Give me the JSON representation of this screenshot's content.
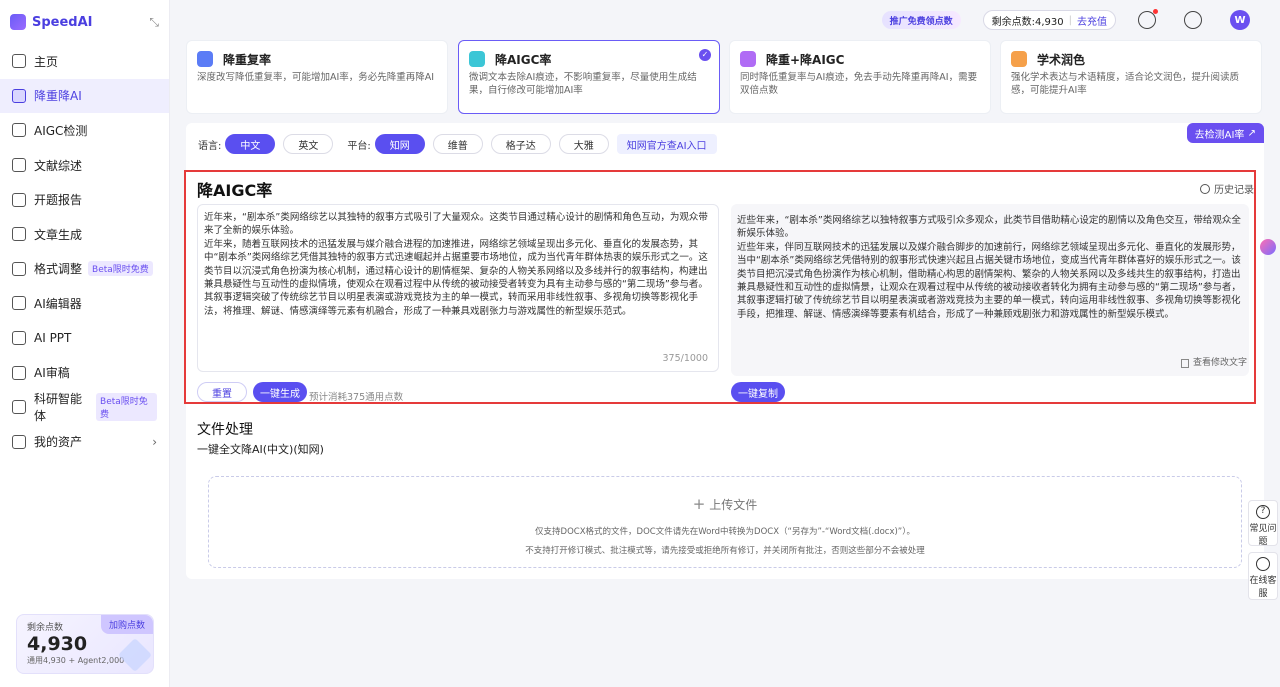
{
  "app": {
    "name": "SpeedAI"
  },
  "sidebar": {
    "items": [
      {
        "label": "主页",
        "icon": "home-icon",
        "badge": ""
      },
      {
        "label": "降重降AI",
        "icon": "magic-wand-icon",
        "badge": ""
      },
      {
        "label": "AIGC检测",
        "icon": "ai-scan-icon",
        "badge": ""
      },
      {
        "label": "文献综述",
        "icon": "document-icon",
        "badge": ""
      },
      {
        "label": "开题报告",
        "icon": "calendar-icon",
        "badge": ""
      },
      {
        "label": "文章生成",
        "icon": "article-icon",
        "badge": ""
      },
      {
        "label": "格式调整",
        "icon": "format-icon",
        "badge": "Beta限时免费"
      },
      {
        "label": "AI编辑器",
        "icon": "editor-icon",
        "badge": ""
      },
      {
        "label": "AI PPT",
        "icon": "ppt-icon",
        "badge": ""
      },
      {
        "label": "AI审稿",
        "icon": "review-icon",
        "badge": ""
      },
      {
        "label": "科研智能体",
        "icon": "agent-icon",
        "badge": "Beta限时免费"
      },
      {
        "label": "我的资产",
        "icon": "assets-icon",
        "badge": ""
      }
    ],
    "points_card": {
      "label": "剩余点数",
      "value": "4,930",
      "detail": "通用4,930 + Agent2,000",
      "buy_label": "加购点数"
    }
  },
  "topbar": {
    "promo": "推广免费领点数",
    "balance_label": "剩余点数:4,930",
    "recharge_label": "去充值",
    "avatar_letter": "W"
  },
  "modes": [
    {
      "title": "降重复率",
      "desc": "深度改写降低重复率，可能增加AI率，务必先降重再降AI",
      "color": "#5b7cf6"
    },
    {
      "title": "降AIGC率",
      "desc": "微调文本去除AI痕迹，不影响重复率，尽量使用生成结果，自行修改可能增加AI率",
      "color": "#3cc6d6"
    },
    {
      "title": "降重+降AIGC",
      "desc": "同时降低重复率与AI痕迹，免去手动先降重再降AI，需要双倍点数",
      "color": "#b06cf5"
    },
    {
      "title": "学术润色",
      "desc": "强化学术表达与术语精度，适合论文润色，提升阅读质感，可能提升AI率",
      "color": "#f5a04a"
    }
  ],
  "detect_button": "去检测AI率",
  "options": {
    "language_label": "语言:",
    "languages": [
      "中文",
      "英文"
    ],
    "platform_label": "平台:",
    "platforms": [
      "知网",
      "维普",
      "格子达",
      "大雅"
    ],
    "official_link": "知网官方查AI入口"
  },
  "editor": {
    "title": "降AIGC率",
    "history_label": "历史记录",
    "input_text": [
      "近年来，“剧本杀”类网络综艺以其独特的叙事方式吸引了大量观众。这类节目通过精心设计的剧情和角色互动，为观众带来了全新的娱乐体验。",
      "近年来，随着互联网技术的迅猛发展与媒介融合进程的加速推进，网络综艺领域呈现出多元化、垂直化的发展态势，其中“剧本杀”类网络综艺凭借其独特的叙事方式迅速崛起并占据重要市场地位，成为当代青年群体热衷的娱乐形式之一。这类节目以沉浸式角色扮演为核心机制，通过精心设计的剧情框架、复杂的人物关系网络以及多线并行的叙事结构，构建出兼具悬疑性与互动性的虚拟情境，使观众在观看过程中从传统的被动接受者转变为具有主动参与感的“第二现场”参与者。其叙事逻辑突破了传统综艺节目以明星表演或游戏竞技为主的单一模式，转而采用非线性叙事、多视角切换等影视化手法，将推理、解谜、情感演绎等元素有机融合，形成了一种兼具戏剧张力与游戏属性的新型娱乐范式。"
    ],
    "char_count": "375/1000",
    "output_text": [
      "近些年来，“剧本杀”类网络综艺以独特叙事方式吸引众多观众，此类节目借助精心设定的剧情以及角色交互，带给观众全新娱乐体验。",
      "近些年来，伴同互联网技术的迅猛发展以及媒介融合脚步的加速前行，网络综艺领域呈现出多元化、垂直化的发展形势，当中“剧本杀”类网络综艺凭借特别的叙事形式快速兴起且占据关键市场地位，变成当代青年群体喜好的娱乐形式之一。该类节目把沉浸式角色扮演作为核心机制，借助精心构思的剧情架构、繁杂的人物关系网以及多线共生的叙事结构，打造出兼具悬疑性和互动性的虚拟情景，让观众在观看过程中从传统的被动接收者转化为拥有主动参与感的“第二现场”参与者，其叙事逻辑打破了传统综艺节目以明星表演或者游戏竞技为主要的单一模式，转向运用非线性叙事、多视角切换等影视化手段，把推理、解谜、情感演绎等要素有机结合，形成了一种兼顾戏剧张力和游戏属性的新型娱乐模式。"
    ],
    "view_changes_label": "查看修改文字",
    "reset_label": "重置",
    "generate_label": "一键生成",
    "estimate": "预计消耗375通用点数",
    "copy_label": "一键复制"
  },
  "file_section": {
    "title": "文件处理",
    "subtitle": "一键全文降AI(中文)(知网)",
    "upload_label": "上传文件",
    "note1": "仅支持DOCX格式的文件，DOC文件请先在Word中转换为DOCX（“另存为”-“Word文档(.docx)”）。",
    "note2": "不支持打开修订模式、批注模式等，请先接受或拒绝所有修订，并关闭所有批注，否则这些部分不会被处理"
  },
  "floating": {
    "faq_label": "常见问题",
    "service_label": "在线客服"
  }
}
